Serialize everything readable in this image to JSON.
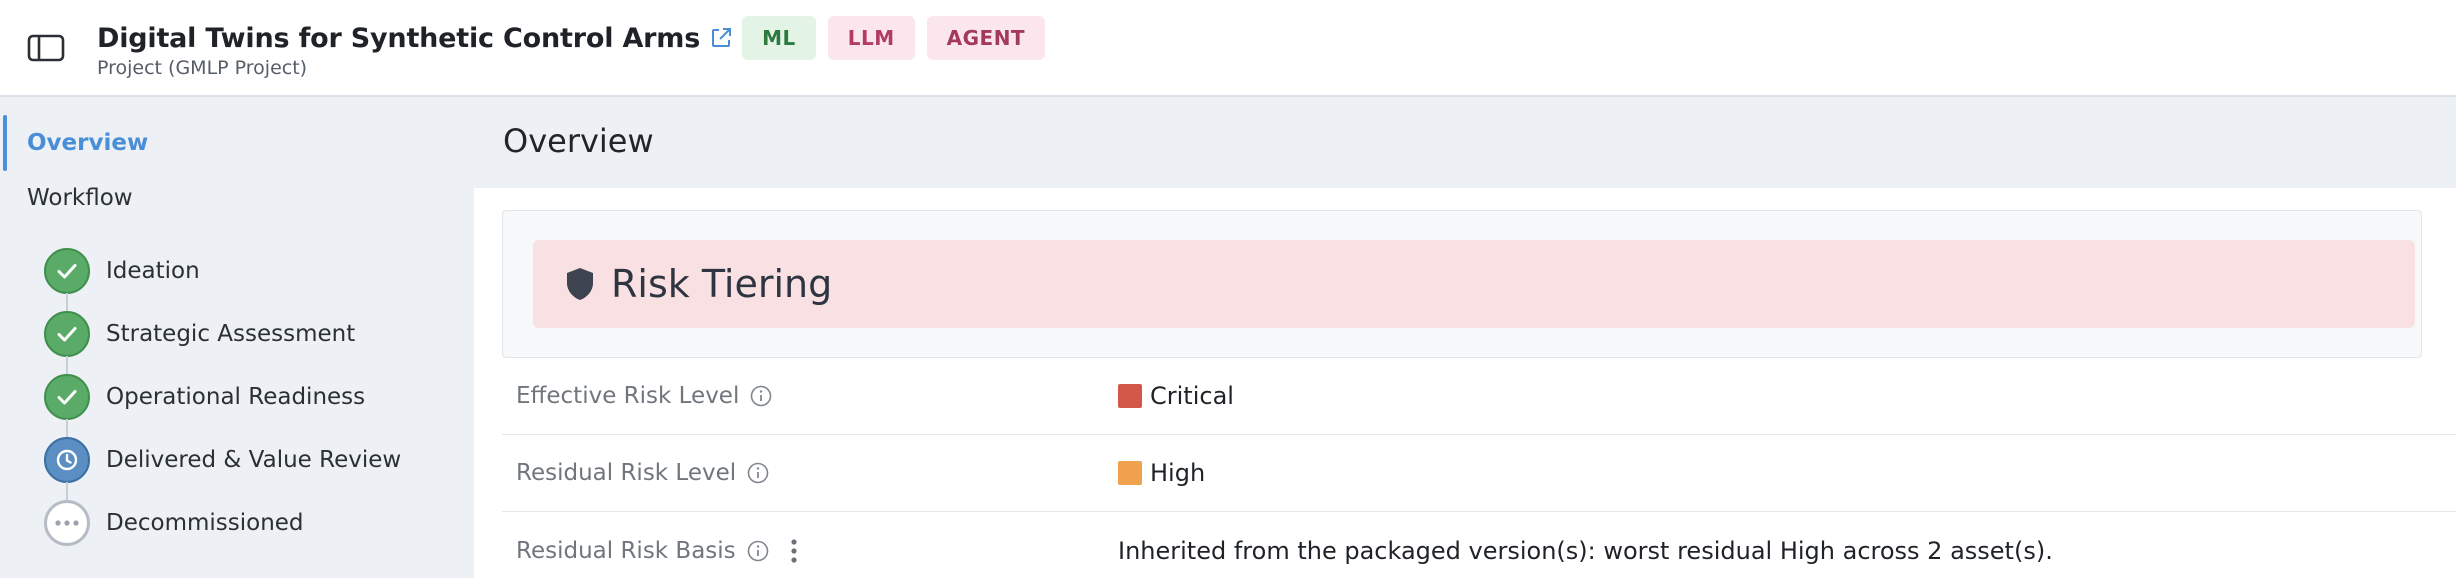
{
  "header": {
    "title": "Digital Twins for Synthetic Control Arms",
    "subtitle": "Project (GMLP Project)",
    "tags": [
      "ML",
      "LLM",
      "AGENT"
    ]
  },
  "sidebar": {
    "overview_label": "Overview",
    "workflow_label": "Workflow",
    "steps": [
      {
        "label": "Ideation",
        "status": "complete",
        "icon": "check-icon"
      },
      {
        "label": "Strategic Assessment",
        "status": "complete",
        "icon": "check-icon"
      },
      {
        "label": "Operational Readiness",
        "status": "complete",
        "icon": "check-icon"
      },
      {
        "label": "Delivered & Value Review",
        "status": "in-progress",
        "icon": "clock-icon"
      },
      {
        "label": "Decommissioned",
        "status": "pending",
        "icon": "ellipsis-icon"
      }
    ]
  },
  "main": {
    "title": "Overview",
    "risk_section_title": "Risk Tiering",
    "rows": [
      {
        "label": "Effective Risk Level",
        "value": "Critical",
        "color": "#d4584a"
      },
      {
        "label": "Residual Risk Level",
        "value": "High",
        "color": "#f0a14b"
      },
      {
        "label": "Residual Risk Basis",
        "value": "Inherited from the packaged version(s): worst residual High across 2 asset(s)."
      }
    ]
  },
  "colors": {
    "accent": "#4a8fd6",
    "complete": "#5aab68",
    "in_progress": "#5b8fc4",
    "risk_banner_bg": "#f9e1e3"
  }
}
